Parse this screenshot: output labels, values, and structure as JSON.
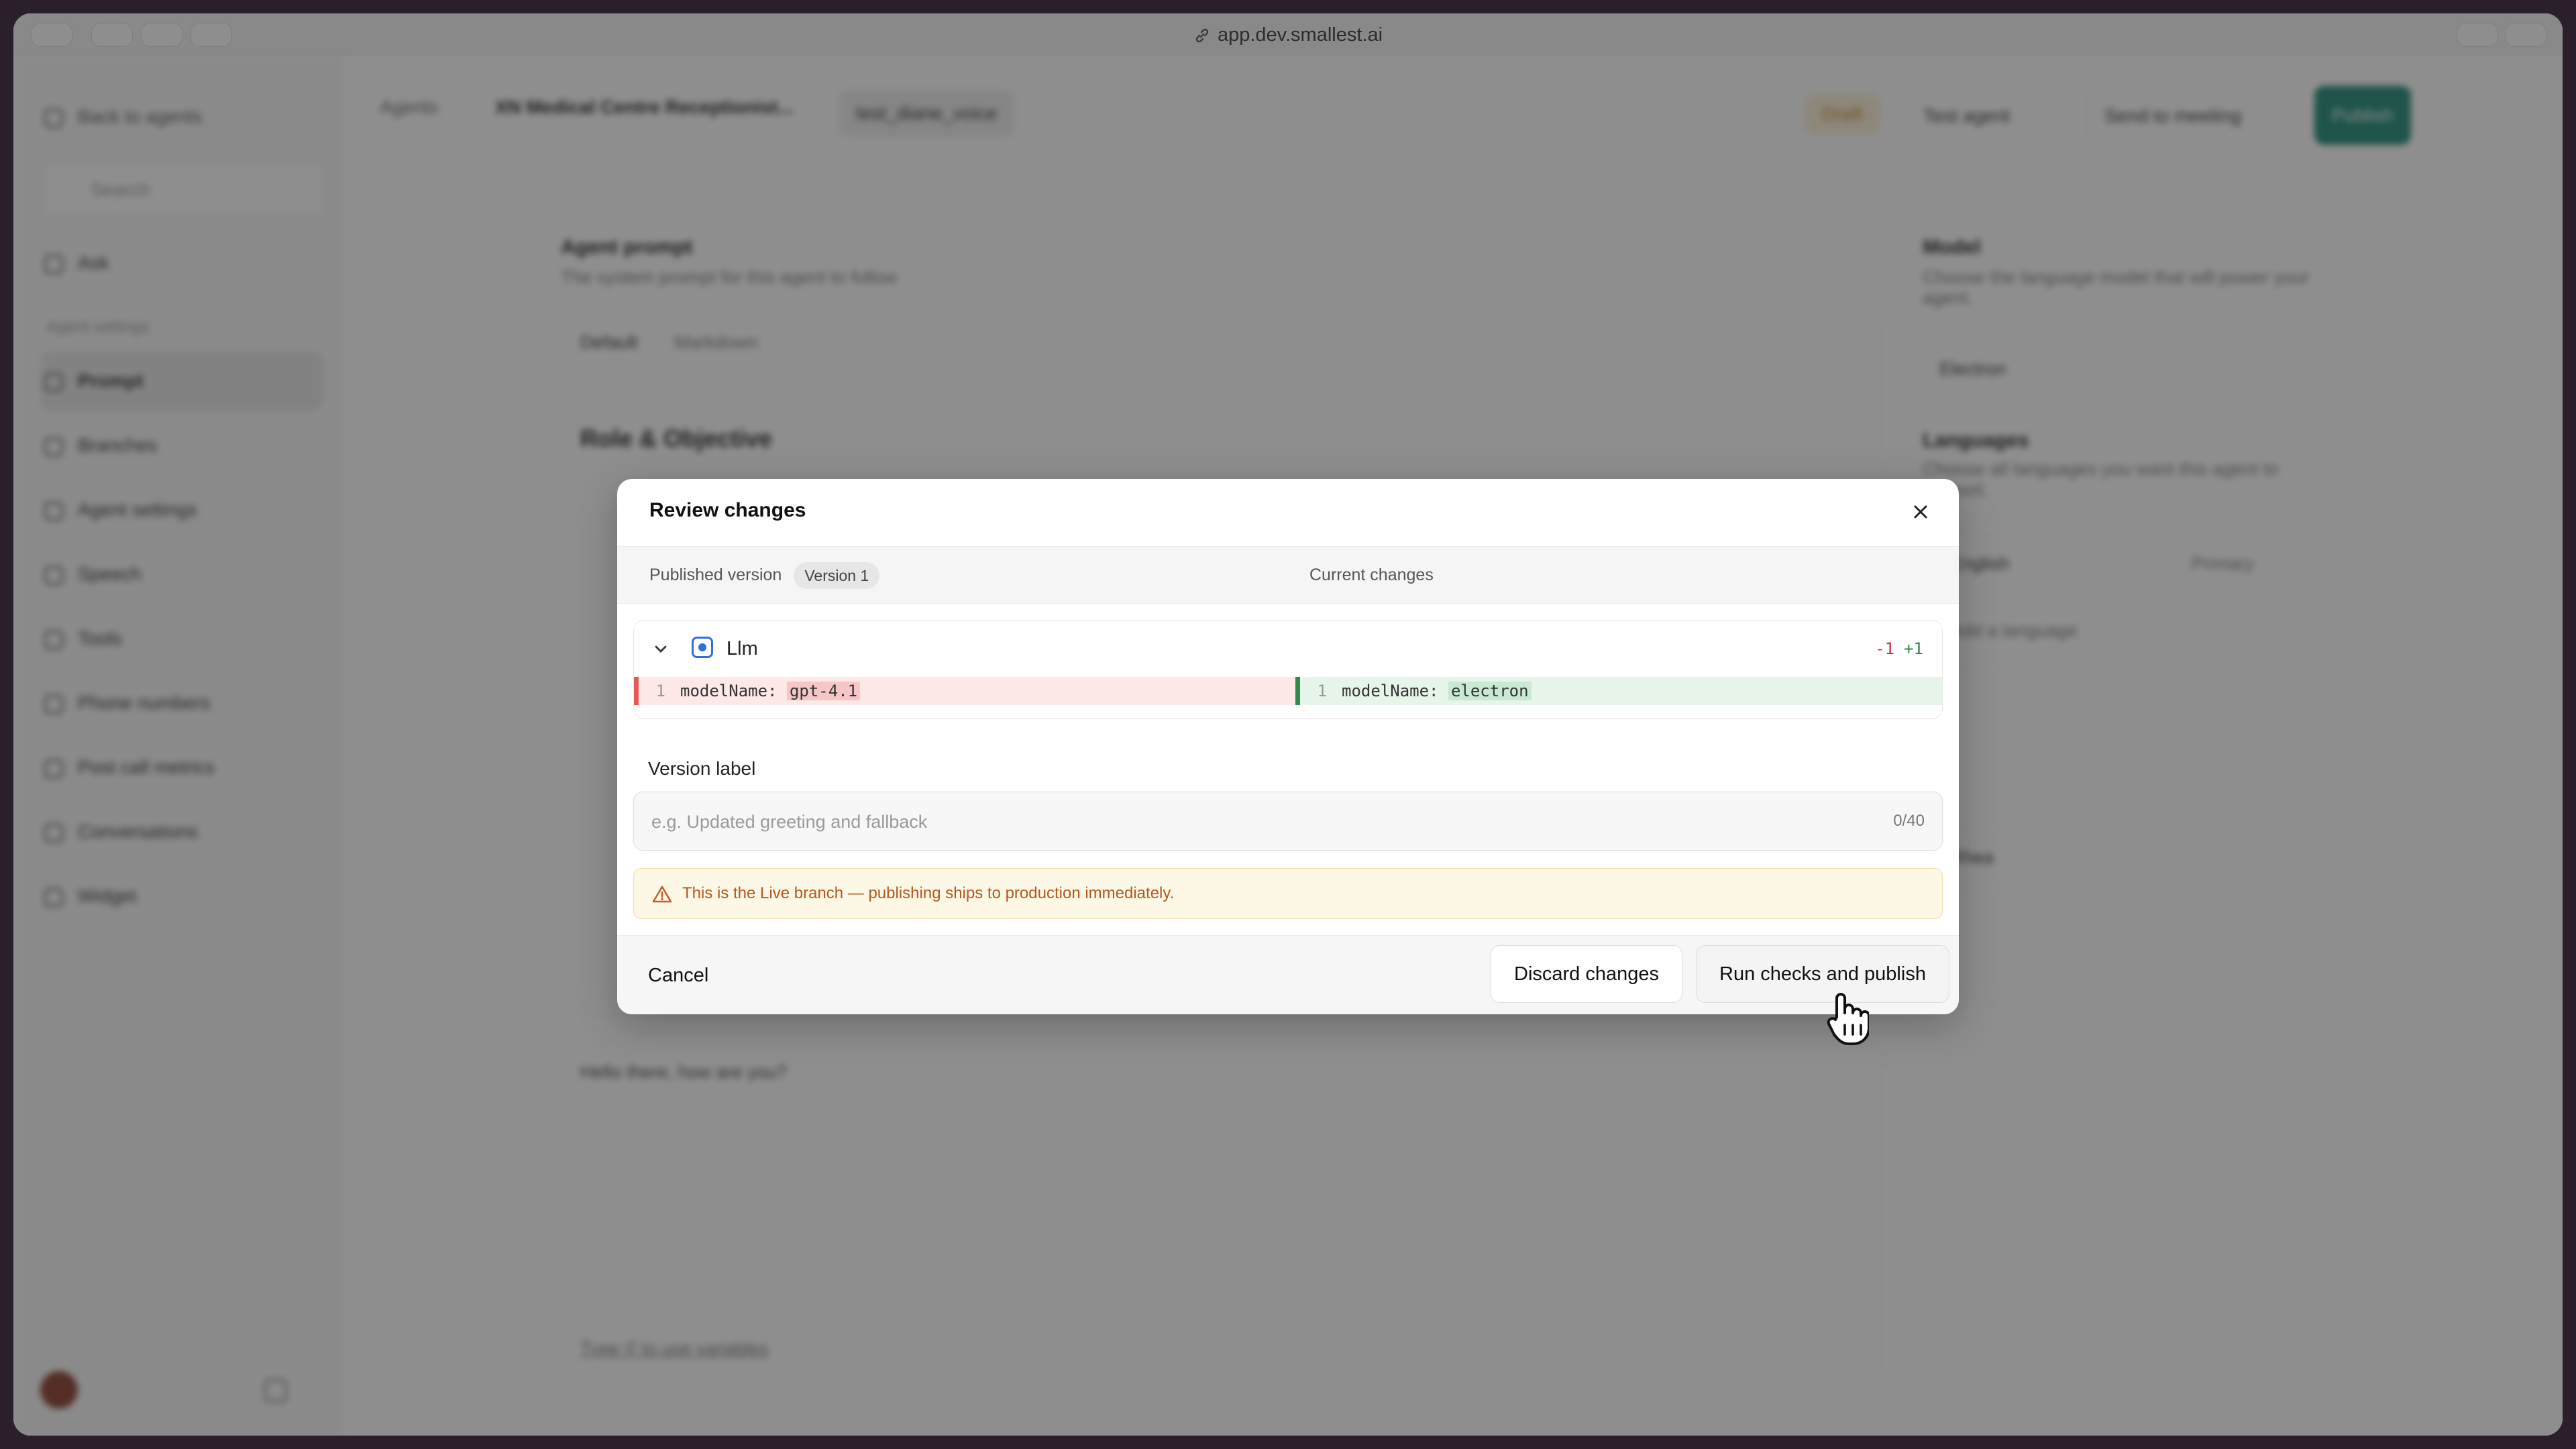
{
  "browser": {
    "url": "app.dev.smallest.ai"
  },
  "background_app": {
    "sidebar": {
      "back": "Back to agents",
      "search_placeholder": "Search",
      "section": "Agent settings",
      "items": [
        "Ask",
        "Prompt",
        "Branches",
        "Agent settings",
        "Speech",
        "Tools",
        "Phone numbers",
        "Post call metrics",
        "Conversations",
        "Widget"
      ]
    },
    "topbar": {
      "crumb_agents": "Agents",
      "agent_name": "XN Medical Centre Receptionist...",
      "branch": "test_diane_voice",
      "badge": "Draft",
      "test_agent": "Test agent",
      "send_meeting": "Send to meeting",
      "publish": "Publish"
    },
    "prompt_section": {
      "title": "Agent prompt",
      "subtitle": "The system prompt for this agent to follow",
      "tab_default": "Default",
      "tab_markdown": "Markdown",
      "heading": "Role & Objective",
      "first_msg_sample": "Hello there, how are you?",
      "variables_hint": "Type {{ to use variables"
    },
    "right_section": {
      "model_title": "Model",
      "model_subtitle": "Choose the language model that will power your agent.",
      "model_value": "Electron",
      "lang_title": "Languages",
      "lang_subtitle": "Choose all languages you want this agent to support.",
      "lang_value": "English",
      "lang_badge": "Primary",
      "add_lang": "Add a language",
      "voice_value": "Rhea"
    }
  },
  "modal": {
    "title": "Review changes",
    "published_label": "Published version",
    "version_badge": "Version 1",
    "current_label": "Current changes",
    "diff": {
      "section": "Llm",
      "deletions": "-1",
      "additions": "+1",
      "left_line_no": "1",
      "left_key": "modelName: ",
      "left_value": "gpt-4.1",
      "right_line_no": "1",
      "right_key": "modelName: ",
      "right_value": "electron"
    },
    "version_label": {
      "label": "Version label",
      "placeholder": "e.g. Updated greeting and fallback",
      "counter": "0/40"
    },
    "warning": "This is the Live branch — publishing ships to production immediately.",
    "cancel": "Cancel",
    "discard": "Discard changes",
    "publish": "Run checks and publish"
  }
}
